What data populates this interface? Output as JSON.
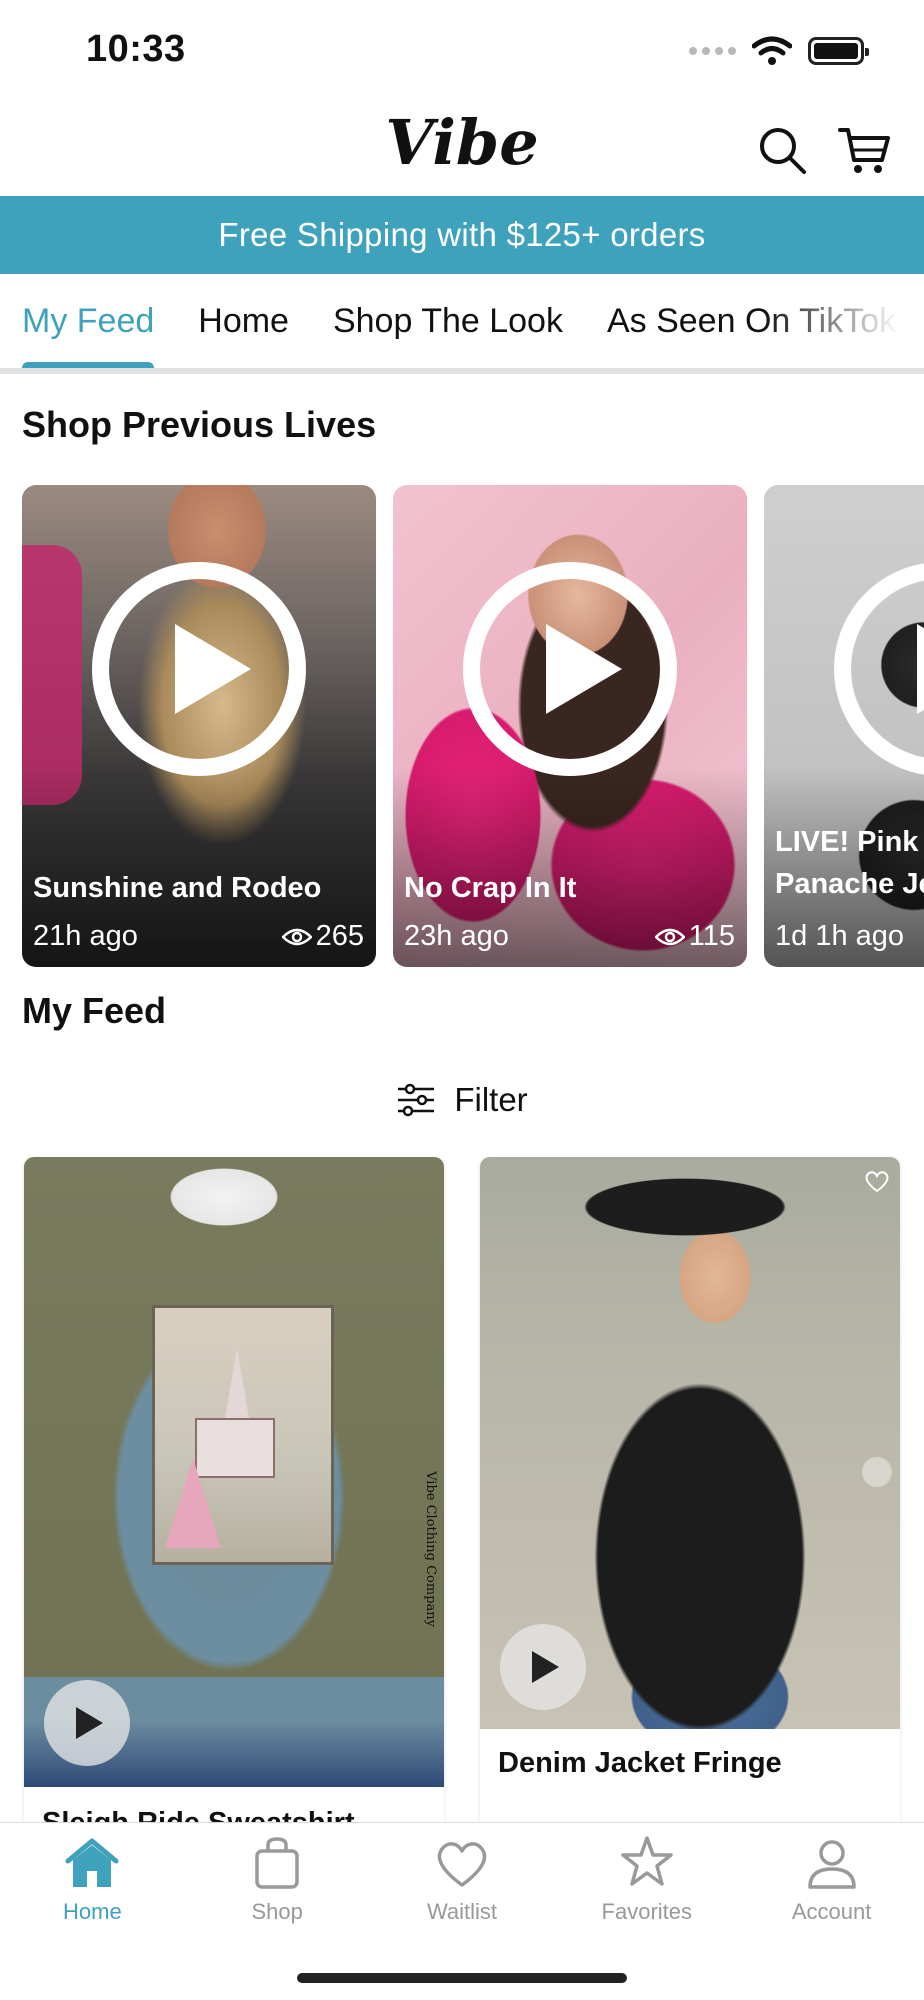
{
  "status_bar": {
    "time": "10:33"
  },
  "header": {
    "logo": "Vibe",
    "search_icon": "search-icon",
    "cart_icon": "cart-icon"
  },
  "banner": {
    "text": "Free Shipping with $125+ orders",
    "color": "#3fa2bd"
  },
  "tabs": [
    {
      "label": "My Feed",
      "active": true
    },
    {
      "label": "Home"
    },
    {
      "label": "Shop The Look"
    },
    {
      "label": "As Seen On TikTok"
    }
  ],
  "sections": {
    "lives_title": "Shop Previous Lives",
    "feed_title": "My Feed"
  },
  "lives": [
    {
      "title": "Sunshine and Rodeo",
      "time": "21h ago",
      "views": "265"
    },
    {
      "title": "No Crap In It",
      "time": "23h ago",
      "views": "115"
    },
    {
      "title": "LIVE! Pink Panache Je",
      "title_line1": "LIVE! Pink",
      "title_line2": "Panache Je",
      "time": "1d 1h ago"
    }
  ],
  "filter": {
    "label": "Filter"
  },
  "products": [
    {
      "name": "Sleigh Ride Sweatshirt",
      "image_text": "Vibe Clothing Company"
    },
    {
      "name": "Denim Jacket Fringe"
    }
  ],
  "bottom_nav": [
    {
      "label": "Home",
      "icon": "home-icon",
      "active": true
    },
    {
      "label": "Shop",
      "icon": "shopping-bag-icon"
    },
    {
      "label": "Waitlist",
      "icon": "heart-icon"
    },
    {
      "label": "Favorites",
      "icon": "star-icon"
    },
    {
      "label": "Account",
      "icon": "person-icon"
    }
  ],
  "accent_color": "#3fa2bd"
}
